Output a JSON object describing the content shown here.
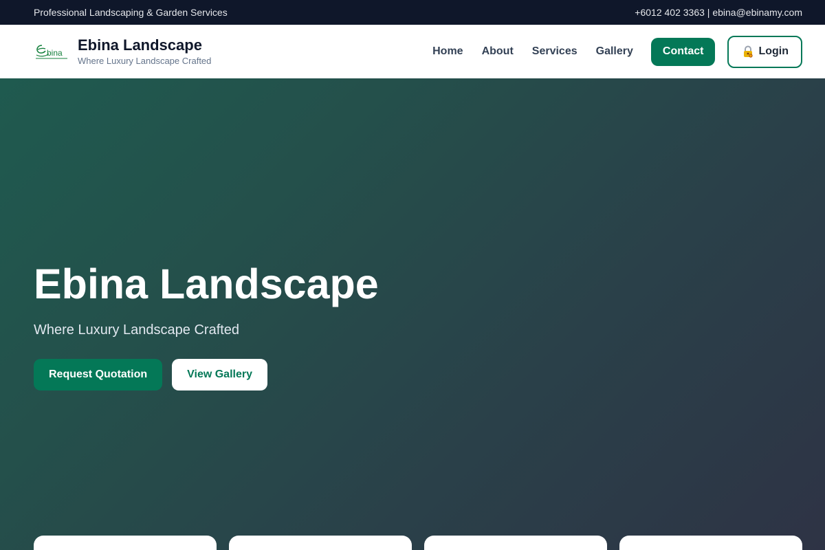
{
  "topbar": {
    "tagline": "Professional Landscaping & Garden Services",
    "contact": "+6012 402 3363 | ebina@ebinamy.com"
  },
  "header": {
    "logo_icon": "ebina-logo",
    "logo_text": "ebina",
    "brand_name": "Ebina Landscape",
    "brand_tagline": "Where Luxury Landscape Crafted",
    "nav": [
      {
        "label": "Home"
      },
      {
        "label": "About"
      },
      {
        "label": "Services"
      },
      {
        "label": "Gallery"
      }
    ],
    "contact_label": "Contact",
    "login_icon": "lock-icon",
    "login_label": "Login"
  },
  "hero": {
    "title": "Ebina Landscape",
    "subtitle": "Where Luxury Landscape Crafted",
    "primary_cta": "Request Quotation",
    "secondary_cta": "View Gallery"
  },
  "colors": {
    "accent": "#047857",
    "topbar_bg": "#0f172a",
    "hero_gradient_start": "#1f5a4f",
    "hero_gradient_end": "#2e3345"
  }
}
